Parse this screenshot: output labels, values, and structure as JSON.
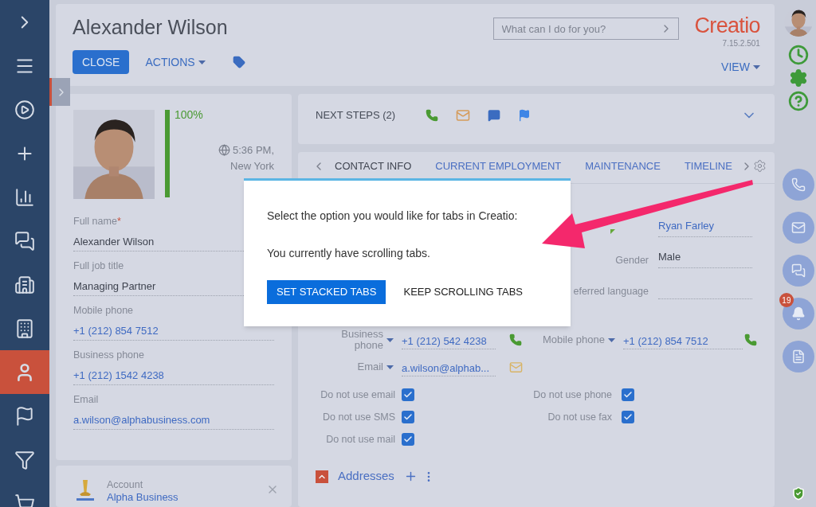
{
  "sidebar": {
    "items": [
      {
        "selected": false
      },
      {
        "selected": false
      },
      {
        "selected": false
      },
      {
        "selected": false
      },
      {
        "selected": false
      },
      {
        "selected": false
      },
      {
        "selected": false
      },
      {
        "selected": false
      },
      {
        "selected": true
      },
      {
        "selected": false
      },
      {
        "selected": false
      },
      {
        "selected": false
      }
    ]
  },
  "header": {
    "title": "Alexander Wilson",
    "close": "CLOSE",
    "actions": "ACTIONS",
    "search": {
      "placeholder": "What can I do for you?"
    },
    "logo": "Creatio",
    "version": "7.15.2.501",
    "view": "VIEW"
  },
  "profile": {
    "completeness": "100%",
    "level": 1,
    "time": "5:36 PM,",
    "city": "New York",
    "required_mark": "*",
    "fields": [
      {
        "label": "Full name",
        "required": true,
        "value": "Alexander Wilson",
        "kind": "text"
      },
      {
        "label": "Full job title",
        "required": false,
        "value": "Managing Partner",
        "kind": "text"
      },
      {
        "label": "Mobile phone",
        "required": false,
        "value": "+1 (212) 854 7512",
        "kind": "link"
      },
      {
        "label": "Business phone",
        "required": false,
        "value": "+1 (212) 1542 4238",
        "kind": "link"
      },
      {
        "label": "Email",
        "required": false,
        "value": "a.wilson@alphabusiness.com",
        "kind": "link"
      }
    ]
  },
  "account": {
    "label": "Account",
    "value": "Alpha Business"
  },
  "next_steps": {
    "label": "NEXT STEPS (2)"
  },
  "tabs": [
    {
      "label": "CONTACT INFO",
      "selected": true
    },
    {
      "label": "CURRENT EMPLOYMENT",
      "selected": false
    },
    {
      "label": "MAINTENANCE",
      "selected": false
    },
    {
      "label": "TIMELINE",
      "selected": false
    }
  ],
  "details": [
    {
      "value": "Ryan Farley",
      "kind": "link"
    },
    {
      "label": "Gender",
      "value": "Male",
      "kind": "text"
    },
    {
      "label": "eferred language",
      "kind": "text"
    }
  ],
  "communications": [
    {
      "label": "Business phone",
      "value": "+1 (212) 542 4238",
      "kind": "phone"
    },
    {
      "label": "Mobile phone",
      "value": "+1 (212) 854 7512",
      "kind": "phone"
    },
    {
      "label": "Email",
      "value": "a.wilson@alphab...",
      "kind": "email"
    }
  ],
  "options": [
    {
      "label": "Do not use email",
      "checked": true
    },
    {
      "label": "Do not use phone",
      "checked": true
    },
    {
      "label": "Do not use SMS",
      "checked": true
    },
    {
      "label": "Do not use fax",
      "checked": true
    },
    {
      "label": "Do not use mail",
      "checked": true
    }
  ],
  "addresses": {
    "label": "Addresses",
    "expanded": true
  },
  "notifications": {
    "badge": "19"
  },
  "dialog": {
    "prompt": "Select the option you would like for tabs in Creatio:",
    "status": "You currently have scrolling tabs.",
    "primary": "SET STACKED TABS",
    "secondary": "KEEP SCROLLING TABS"
  }
}
